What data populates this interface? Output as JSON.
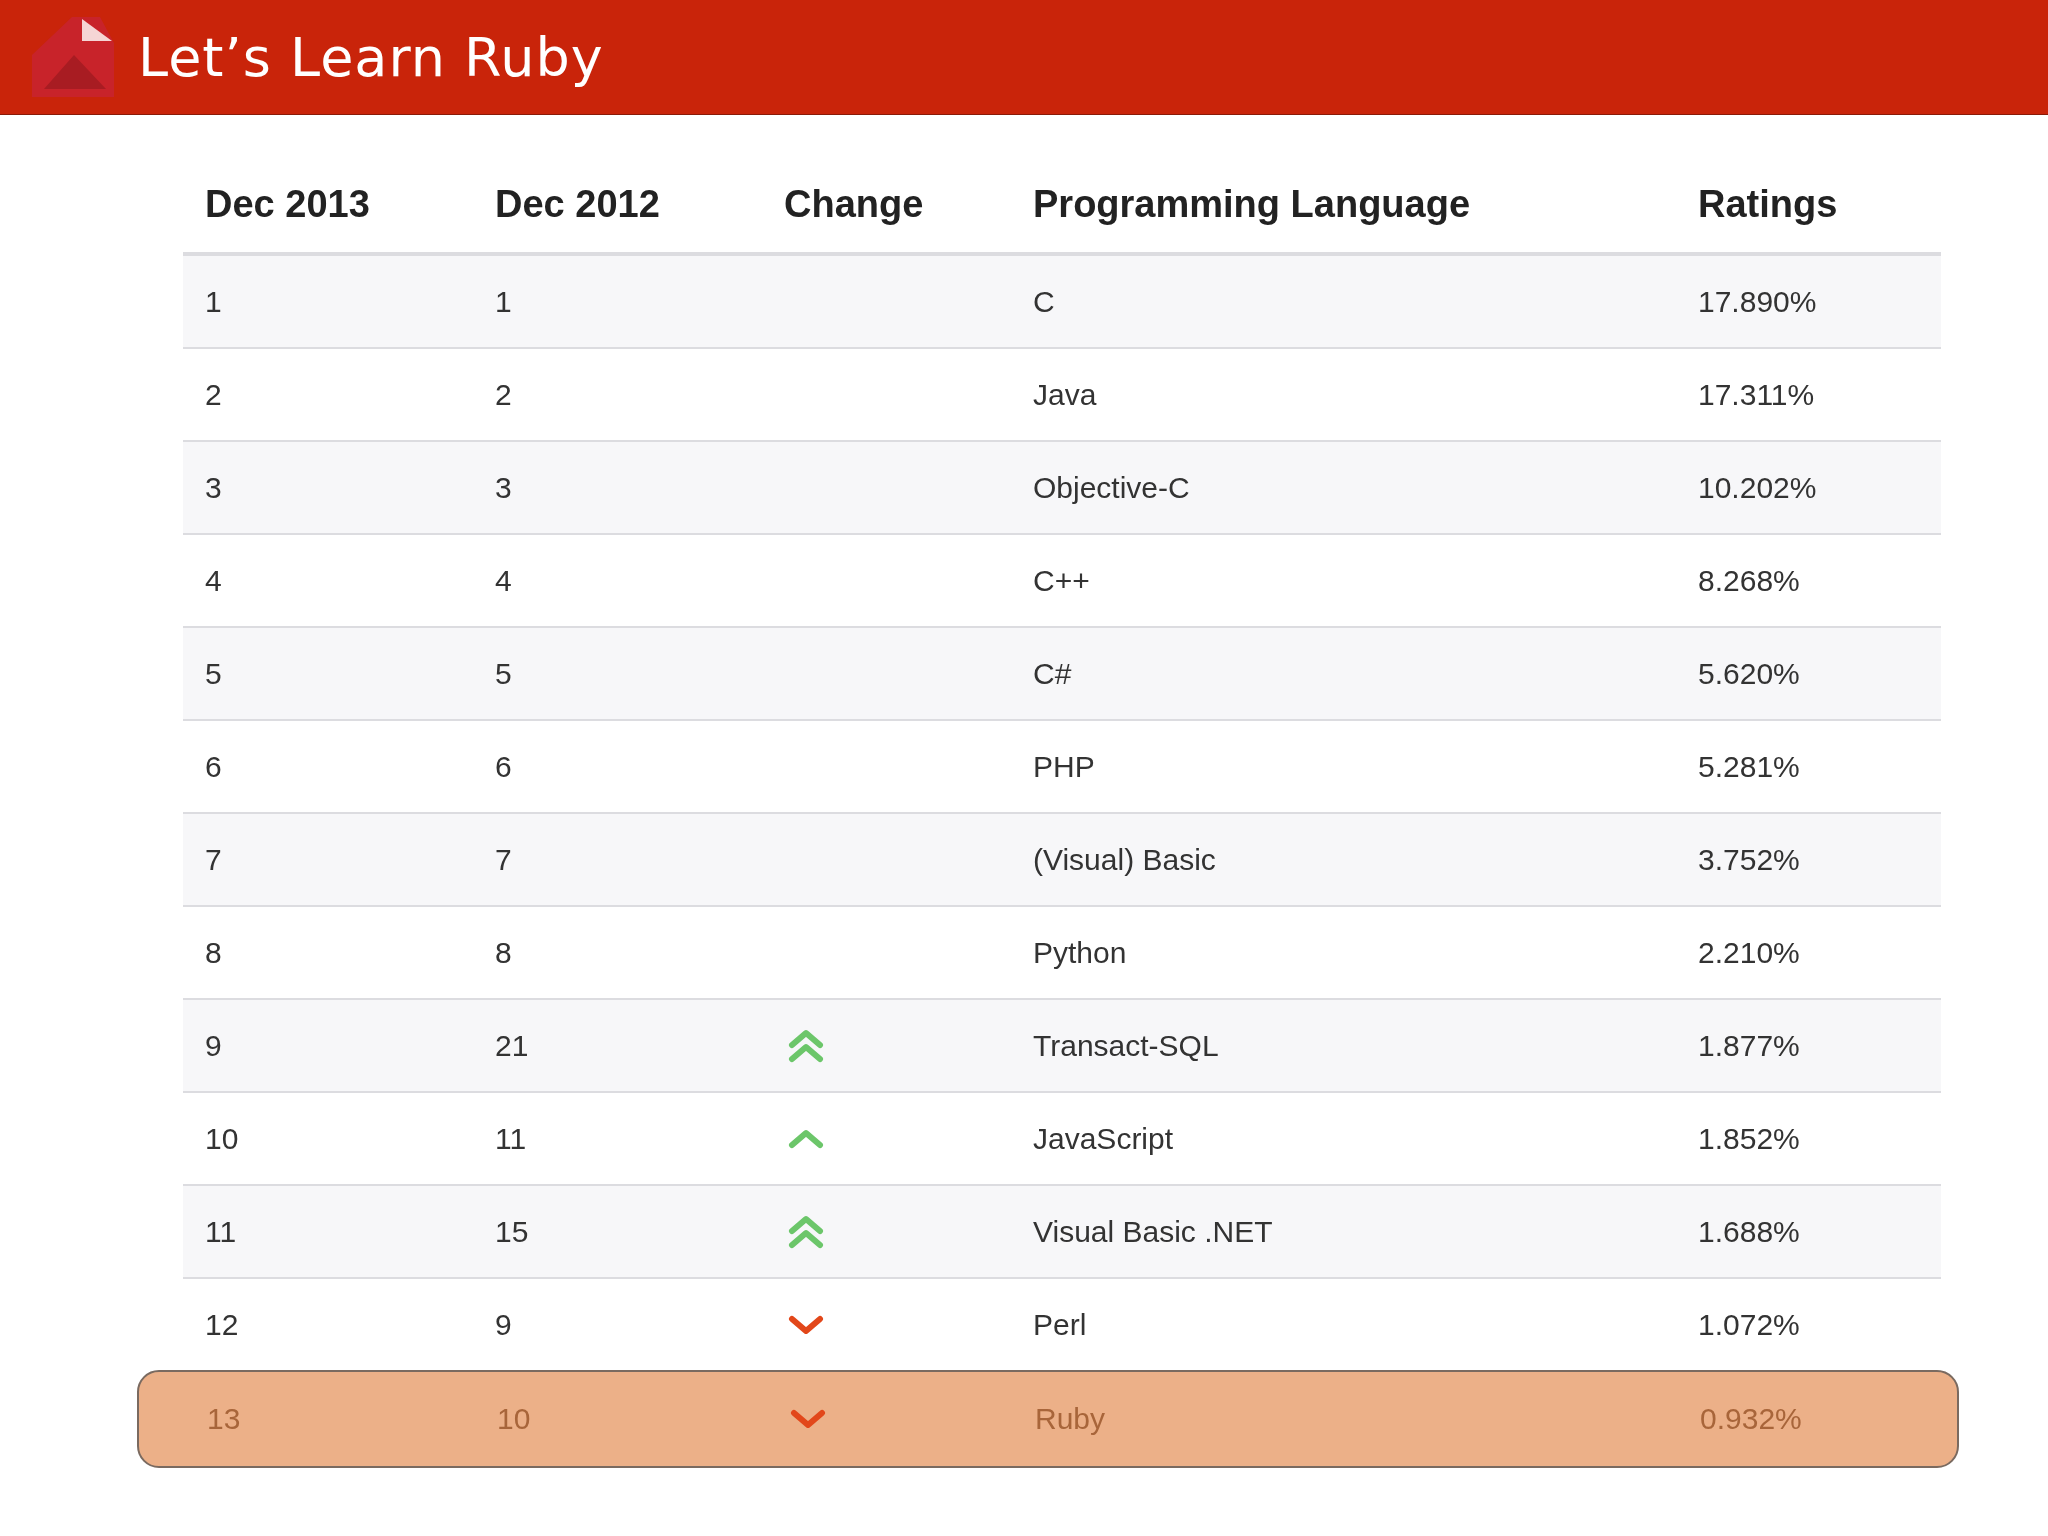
{
  "header": {
    "title": "Let’s Learn Ruby"
  },
  "table": {
    "columns": [
      "Dec 2013",
      "Dec 2012",
      "Change",
      "Programming Language",
      "Ratings"
    ],
    "rows": [
      {
        "dec_2013": "1",
        "dec_2012": "1",
        "kind": "steady",
        "language": "C",
        "rating": "17.890%",
        "highlighted": false
      },
      {
        "dec_2013": "2",
        "dec_2012": "2",
        "kind": "steady",
        "language": "Java",
        "rating": "17.311%",
        "highlighted": false
      },
      {
        "dec_2013": "3",
        "dec_2012": "3",
        "kind": "steady",
        "language": "Objective-C",
        "rating": "10.202%",
        "highlighted": false
      },
      {
        "dec_2013": "4",
        "dec_2012": "4",
        "kind": "steady",
        "language": "C++",
        "rating": "8.268%",
        "highlighted": false
      },
      {
        "dec_2013": "5",
        "dec_2012": "5",
        "kind": "steady",
        "language": "C#",
        "rating": "5.620%",
        "highlighted": false
      },
      {
        "dec_2013": "6",
        "dec_2012": "6",
        "kind": "steady",
        "language": "PHP",
        "rating": "5.281%",
        "highlighted": false
      },
      {
        "dec_2013": "7",
        "dec_2012": "7",
        "kind": "steady",
        "language": "(Visual) Basic",
        "rating": "3.752%",
        "highlighted": false
      },
      {
        "dec_2013": "8",
        "dec_2012": "8",
        "kind": "steady",
        "language": "Python",
        "rating": "2.210%",
        "highlighted": false
      },
      {
        "dec_2013": "9",
        "dec_2012": "21",
        "kind": "up2",
        "language": "Transact-SQL",
        "rating": "1.877%",
        "highlighted": false
      },
      {
        "dec_2013": "10",
        "dec_2012": "11",
        "kind": "up",
        "language": "JavaScript",
        "rating": "1.852%",
        "highlighted": false
      },
      {
        "dec_2013": "11",
        "dec_2012": "15",
        "kind": "up2",
        "language": "Visual Basic .NET",
        "rating": "1.688%",
        "highlighted": false
      },
      {
        "dec_2013": "12",
        "dec_2012": "9",
        "kind": "down",
        "language": "Perl",
        "rating": "1.072%",
        "highlighted": false
      },
      {
        "dec_2013": "13",
        "dec_2012": "10",
        "kind": "down",
        "language": "Ruby",
        "rating": "0.932%",
        "highlighted": true
      }
    ]
  }
}
